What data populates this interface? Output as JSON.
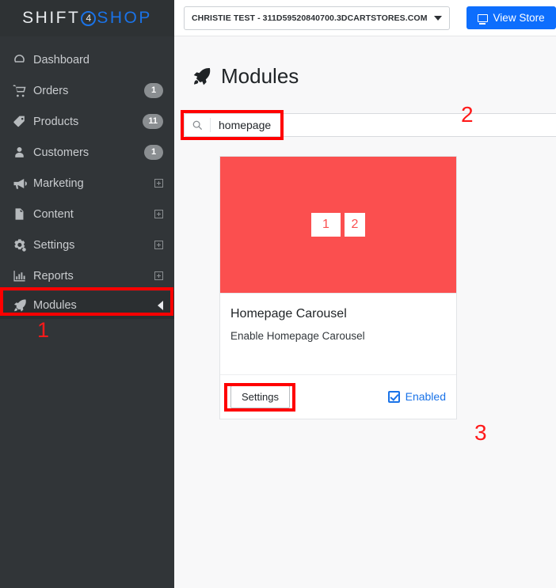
{
  "brand": {
    "part1": "SHIFT",
    "badge": "4",
    "part2": "SHOP"
  },
  "sidebar": {
    "items": [
      {
        "label": "Dashboard",
        "icon": "dashboard-gauge-icon",
        "badge": null,
        "expand": false
      },
      {
        "label": "Orders",
        "icon": "shopping-cart-icon",
        "badge": "1",
        "expand": false
      },
      {
        "label": "Products",
        "icon": "price-tag-icon",
        "badge": "11",
        "expand": false
      },
      {
        "label": "Customers",
        "icon": "user-icon",
        "badge": "1",
        "expand": false
      },
      {
        "label": "Marketing",
        "icon": "megaphone-icon",
        "badge": null,
        "expand": true
      },
      {
        "label": "Content",
        "icon": "document-icon",
        "badge": null,
        "expand": true
      },
      {
        "label": "Settings",
        "icon": "gears-icon",
        "badge": null,
        "expand": true
      },
      {
        "label": "Reports",
        "icon": "bar-chart-icon",
        "badge": null,
        "expand": true
      },
      {
        "label": "Modules",
        "icon": "rocket-icon",
        "badge": null,
        "expand": false,
        "active": true
      }
    ]
  },
  "topbar": {
    "store_selector": "CHRISTIE TEST - 311D59520840700.3DCARTSTORES.COM",
    "view_store_label": "View Store"
  },
  "main": {
    "page_title": "Modules",
    "search": {
      "value": "homepage",
      "placeholder": ""
    },
    "card": {
      "thumb_tile_1": "1",
      "thumb_tile_2": "2",
      "title": "Homepage Carousel",
      "description": "Enable Homepage Carousel",
      "settings_label": "Settings",
      "enabled_label": "Enabled",
      "enabled_checked": true
    }
  },
  "annotations": {
    "step_1": "1",
    "step_2": "2",
    "step_3": "3"
  },
  "colors": {
    "sidebar_bg": "#313538",
    "accent_blue": "#0d6efd",
    "annotation_red": "#ff0000",
    "thumb_red": "#fb4f4f"
  }
}
